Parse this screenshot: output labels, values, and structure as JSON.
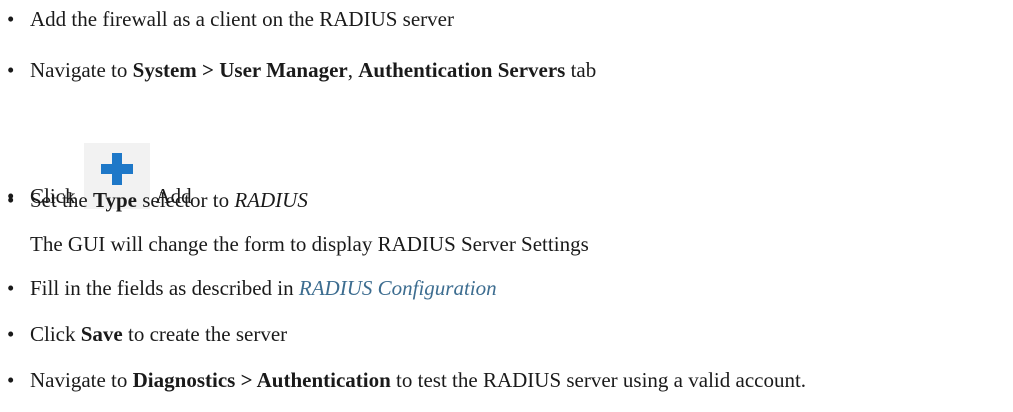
{
  "steps": [
    {
      "bullet": "•",
      "text": "Add the firewall as a client on the RADIUS server"
    },
    {
      "bullet": "•",
      "pre": "Navigate to ",
      "bold1": "System > User Manager",
      "mid": ", ",
      "bold2": "Authentication Servers",
      "post": " tab"
    },
    {
      "bullet": "•",
      "pre": "Click",
      "icon": "plus-icon",
      "post": "Add"
    },
    {
      "bullet": "•",
      "pre": "Set the ",
      "bold": "Type",
      "mid": " selector to ",
      "italic": "RADIUS"
    },
    {
      "note": "The GUI will change the form to display RADIUS Server Settings"
    },
    {
      "bullet": "•",
      "pre": "Fill in the fields as described in ",
      "link": "RADIUS Configuration"
    },
    {
      "bullet": "•",
      "pre": "Click ",
      "bold": "Save",
      "post": " to create the server"
    },
    {
      "bullet": "•",
      "pre": "Navigate to ",
      "bold": "Diagnostics > Authentication",
      "post": " to test the RADIUS server using a valid account."
    }
  ],
  "colors": {
    "link": "#3d6d90",
    "plus_icon": "#1e78c8",
    "icon_background": "#f2f2f2"
  }
}
